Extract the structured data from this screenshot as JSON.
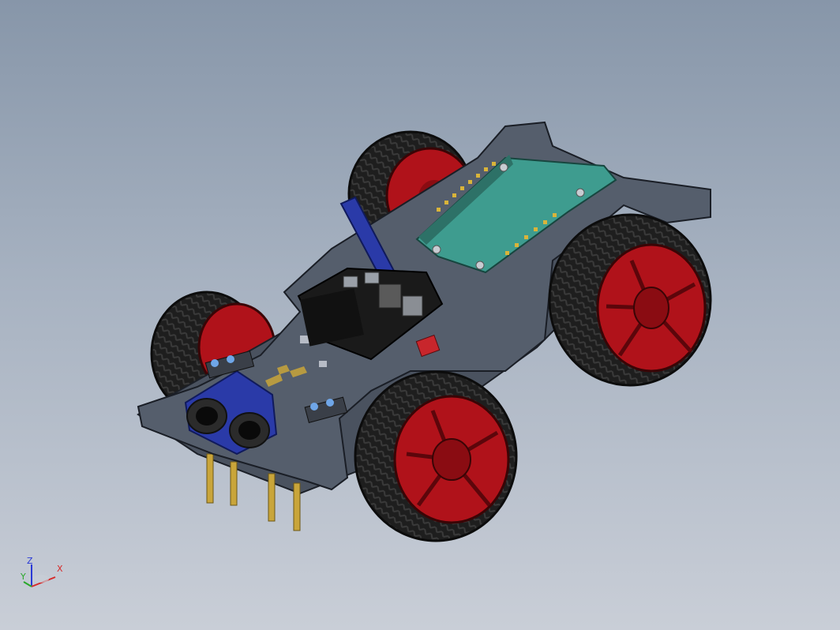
{
  "app": {
    "view": "isometric"
  },
  "colors": {
    "background_top": "#8796a9",
    "background_bottom": "#c9ced7",
    "chassis_plate": "#555e6c",
    "tire": "#1c1c1c",
    "rim": "#b0121a",
    "pcb_green": "#3e9c8f",
    "pcb_blue": "#2a3aa8",
    "brass_standoff": "#c9a53a"
  },
  "triad": {
    "z_label": "Z",
    "x_label": "X",
    "y_label": "Y",
    "z_color": "#2a3ad6",
    "x_color": "#d62a2a",
    "y_color": "#2aa82a"
  }
}
